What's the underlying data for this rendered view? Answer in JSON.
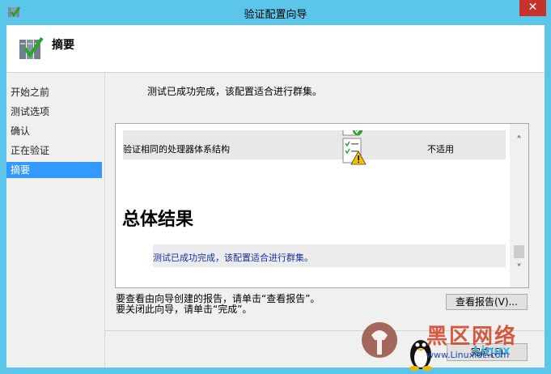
{
  "window": {
    "title": "验证配置向导",
    "close_label": "✕"
  },
  "header": {
    "title": "摘要",
    "icon": "cluster-validate-icon"
  },
  "sidebar": {
    "items": [
      {
        "label": "开始之前",
        "active": false
      },
      {
        "label": "测试选项",
        "active": false
      },
      {
        "label": "确认",
        "active": false
      },
      {
        "label": "正在验证",
        "active": false
      },
      {
        "label": "摘要",
        "active": true
      }
    ]
  },
  "main": {
    "status_line": "测试已成功完成，该配置适合进行群集。",
    "report": {
      "row": {
        "name": "验证相同的处理器体系结构",
        "status": "不适用",
        "icon": "warning-checklist-icon"
      },
      "overall_title": "总体结果",
      "overall_text": "测试已成功完成，该配置适合进行群集。"
    },
    "instruction_line1": "要查看由向导创建的报告，请单击“查看报告”。",
    "instruction_line2": "要关闭此向导，请单击“完成”。",
    "view_report_label": "查看报告(V)...",
    "finish_label": "完成(F)"
  },
  "watermark": {
    "line1": "黑区网络",
    "line2": "www.Linuxidc.com",
    "brand": "Linux"
  },
  "colors": {
    "titlebar": "#5bc6ea",
    "accent": "#3399ff",
    "close": "#c7312c"
  }
}
